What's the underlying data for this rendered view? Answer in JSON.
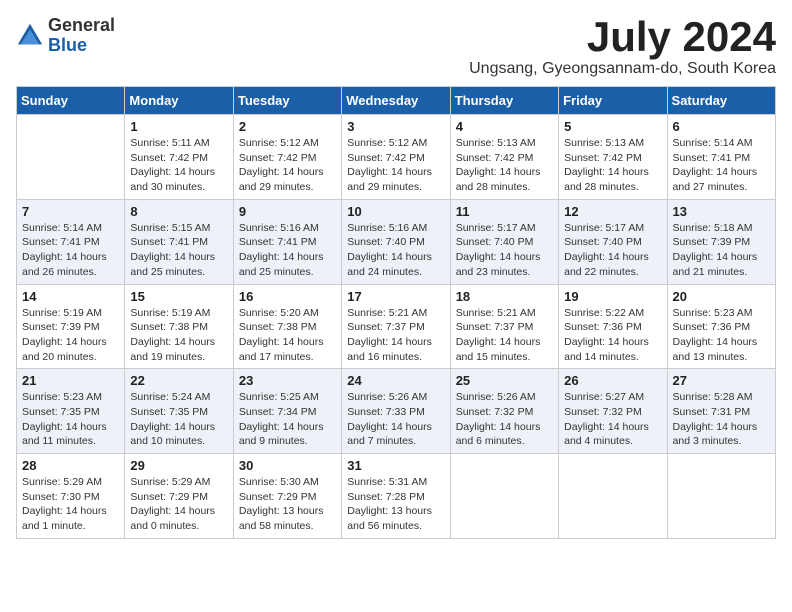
{
  "logo": {
    "general": "General",
    "blue": "Blue"
  },
  "title": "July 2024",
  "location": "Ungsang, Gyeongsannam-do, South Korea",
  "weekdays": [
    "Sunday",
    "Monday",
    "Tuesday",
    "Wednesday",
    "Thursday",
    "Friday",
    "Saturday"
  ],
  "weeks": [
    [
      {
        "day": "",
        "info": ""
      },
      {
        "day": "1",
        "info": "Sunrise: 5:11 AM\nSunset: 7:42 PM\nDaylight: 14 hours\nand 30 minutes."
      },
      {
        "day": "2",
        "info": "Sunrise: 5:12 AM\nSunset: 7:42 PM\nDaylight: 14 hours\nand 29 minutes."
      },
      {
        "day": "3",
        "info": "Sunrise: 5:12 AM\nSunset: 7:42 PM\nDaylight: 14 hours\nand 29 minutes."
      },
      {
        "day": "4",
        "info": "Sunrise: 5:13 AM\nSunset: 7:42 PM\nDaylight: 14 hours\nand 28 minutes."
      },
      {
        "day": "5",
        "info": "Sunrise: 5:13 AM\nSunset: 7:42 PM\nDaylight: 14 hours\nand 28 minutes."
      },
      {
        "day": "6",
        "info": "Sunrise: 5:14 AM\nSunset: 7:41 PM\nDaylight: 14 hours\nand 27 minutes."
      }
    ],
    [
      {
        "day": "7",
        "info": "Sunrise: 5:14 AM\nSunset: 7:41 PM\nDaylight: 14 hours\nand 26 minutes."
      },
      {
        "day": "8",
        "info": "Sunrise: 5:15 AM\nSunset: 7:41 PM\nDaylight: 14 hours\nand 25 minutes."
      },
      {
        "day": "9",
        "info": "Sunrise: 5:16 AM\nSunset: 7:41 PM\nDaylight: 14 hours\nand 25 minutes."
      },
      {
        "day": "10",
        "info": "Sunrise: 5:16 AM\nSunset: 7:40 PM\nDaylight: 14 hours\nand 24 minutes."
      },
      {
        "day": "11",
        "info": "Sunrise: 5:17 AM\nSunset: 7:40 PM\nDaylight: 14 hours\nand 23 minutes."
      },
      {
        "day": "12",
        "info": "Sunrise: 5:17 AM\nSunset: 7:40 PM\nDaylight: 14 hours\nand 22 minutes."
      },
      {
        "day": "13",
        "info": "Sunrise: 5:18 AM\nSunset: 7:39 PM\nDaylight: 14 hours\nand 21 minutes."
      }
    ],
    [
      {
        "day": "14",
        "info": "Sunrise: 5:19 AM\nSunset: 7:39 PM\nDaylight: 14 hours\nand 20 minutes."
      },
      {
        "day": "15",
        "info": "Sunrise: 5:19 AM\nSunset: 7:38 PM\nDaylight: 14 hours\nand 19 minutes."
      },
      {
        "day": "16",
        "info": "Sunrise: 5:20 AM\nSunset: 7:38 PM\nDaylight: 14 hours\nand 17 minutes."
      },
      {
        "day": "17",
        "info": "Sunrise: 5:21 AM\nSunset: 7:37 PM\nDaylight: 14 hours\nand 16 minutes."
      },
      {
        "day": "18",
        "info": "Sunrise: 5:21 AM\nSunset: 7:37 PM\nDaylight: 14 hours\nand 15 minutes."
      },
      {
        "day": "19",
        "info": "Sunrise: 5:22 AM\nSunset: 7:36 PM\nDaylight: 14 hours\nand 14 minutes."
      },
      {
        "day": "20",
        "info": "Sunrise: 5:23 AM\nSunset: 7:36 PM\nDaylight: 14 hours\nand 13 minutes."
      }
    ],
    [
      {
        "day": "21",
        "info": "Sunrise: 5:23 AM\nSunset: 7:35 PM\nDaylight: 14 hours\nand 11 minutes."
      },
      {
        "day": "22",
        "info": "Sunrise: 5:24 AM\nSunset: 7:35 PM\nDaylight: 14 hours\nand 10 minutes."
      },
      {
        "day": "23",
        "info": "Sunrise: 5:25 AM\nSunset: 7:34 PM\nDaylight: 14 hours\nand 9 minutes."
      },
      {
        "day": "24",
        "info": "Sunrise: 5:26 AM\nSunset: 7:33 PM\nDaylight: 14 hours\nand 7 minutes."
      },
      {
        "day": "25",
        "info": "Sunrise: 5:26 AM\nSunset: 7:32 PM\nDaylight: 14 hours\nand 6 minutes."
      },
      {
        "day": "26",
        "info": "Sunrise: 5:27 AM\nSunset: 7:32 PM\nDaylight: 14 hours\nand 4 minutes."
      },
      {
        "day": "27",
        "info": "Sunrise: 5:28 AM\nSunset: 7:31 PM\nDaylight: 14 hours\nand 3 minutes."
      }
    ],
    [
      {
        "day": "28",
        "info": "Sunrise: 5:29 AM\nSunset: 7:30 PM\nDaylight: 14 hours\nand 1 minute."
      },
      {
        "day": "29",
        "info": "Sunrise: 5:29 AM\nSunset: 7:29 PM\nDaylight: 14 hours\nand 0 minutes."
      },
      {
        "day": "30",
        "info": "Sunrise: 5:30 AM\nSunset: 7:29 PM\nDaylight: 13 hours\nand 58 minutes."
      },
      {
        "day": "31",
        "info": "Sunrise: 5:31 AM\nSunset: 7:28 PM\nDaylight: 13 hours\nand 56 minutes."
      },
      {
        "day": "",
        "info": ""
      },
      {
        "day": "",
        "info": ""
      },
      {
        "day": "",
        "info": ""
      }
    ]
  ]
}
